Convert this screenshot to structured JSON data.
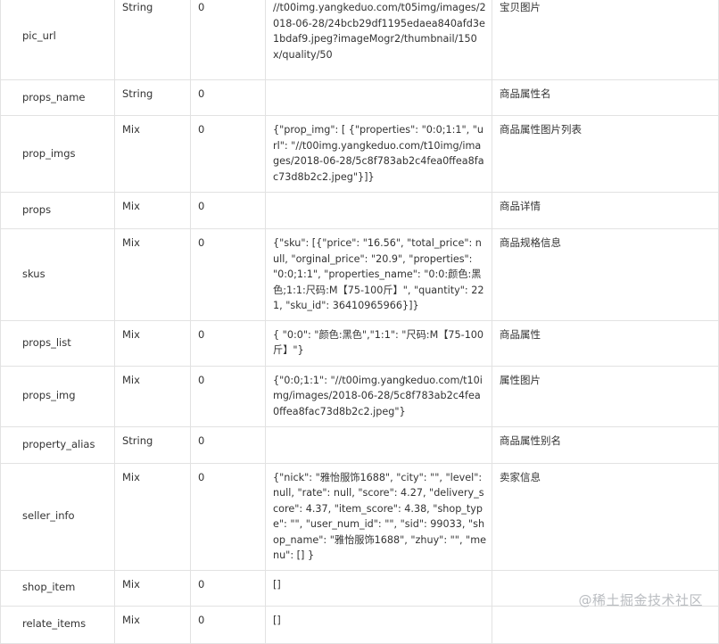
{
  "rows": [
    {
      "field": "pic_url",
      "type": "String",
      "required": "0",
      "example": "//t00img.yangkeduo.com/t05img/images/2018-06-28/24bcb29df1195edaea840afd3e1bdaf9.jpeg?imageMogr2/thumbnail/150x/quality/50",
      "desc": "宝贝图片"
    },
    {
      "field": "props_name",
      "type": "String",
      "required": "0",
      "example": "",
      "desc": "商品属性名"
    },
    {
      "field": "prop_imgs",
      "type": "Mix",
      "required": "0",
      "example": "{\"prop_img\": [ {\"properties\": \"0:0;1:1\", \"url\": \"//t00img.yangkeduo.com/t10img/images/2018-06-28/5c8f783ab2c4fea0ffea8fac73d8b2c2.jpeg\"}]}",
      "desc": "商品属性图片列表"
    },
    {
      "field": "props",
      "type": "Mix",
      "required": "0",
      "example": "",
      "desc": "商品详情"
    },
    {
      "field": "skus",
      "type": "Mix",
      "required": "0",
      "example": "{\"sku\": [{\"price\": \"16.56\", \"total_price\": null, \"orginal_price\": \"20.9\", \"properties\": \"0:0;1:1\", \"properties_name\": \"0:0:颜色:黑色;1:1:尺码:M【75-100斤】\", \"quantity\": 221, \"sku_id\": 36410965966}]}",
      "desc": "商品规格信息"
    },
    {
      "field": "props_list",
      "type": "Mix",
      "required": "0",
      "example": "{ \"0:0\": \"颜色:黑色\",\"1:1\": \"尺码:M【75-100斤】\"}",
      "desc": "商品属性"
    },
    {
      "field": "props_img",
      "type": "Mix",
      "required": "0",
      "example": "{\"0:0;1:1\": \"//t00img.yangkeduo.com/t10img/images/2018-06-28/5c8f783ab2c4fea0ffea8fac73d8b2c2.jpeg\"}",
      "desc": "属性图片"
    },
    {
      "field": "property_alias",
      "type": "String",
      "required": "0",
      "example": "",
      "desc": "商品属性别名"
    },
    {
      "field": "seller_info",
      "type": "Mix",
      "required": "0",
      "example": "{\"nick\": \"雅怡服饰1688\", \"city\": \"\", \"level\": null, \"rate\": null, \"score\": 4.27, \"delivery_score\": 4.37, \"item_score\": 4.38, \"shop_type\": \"\", \"user_num_id\": \"\", \"sid\": 99033, \"shop_name\": \"雅怡服饰1688\", \"zhuy\": \"\", \"menu\": [] }",
      "desc": "卖家信息"
    },
    {
      "field": "shop_item",
      "type": "Mix",
      "required": "0",
      "example": "[]",
      "desc": ""
    },
    {
      "field": "relate_items",
      "type": "Mix",
      "required": "0",
      "example": "[]",
      "desc": ""
    }
  ],
  "watermark": {
    "icon": "at-icon",
    "text": "@稀土掘金技术社区"
  }
}
